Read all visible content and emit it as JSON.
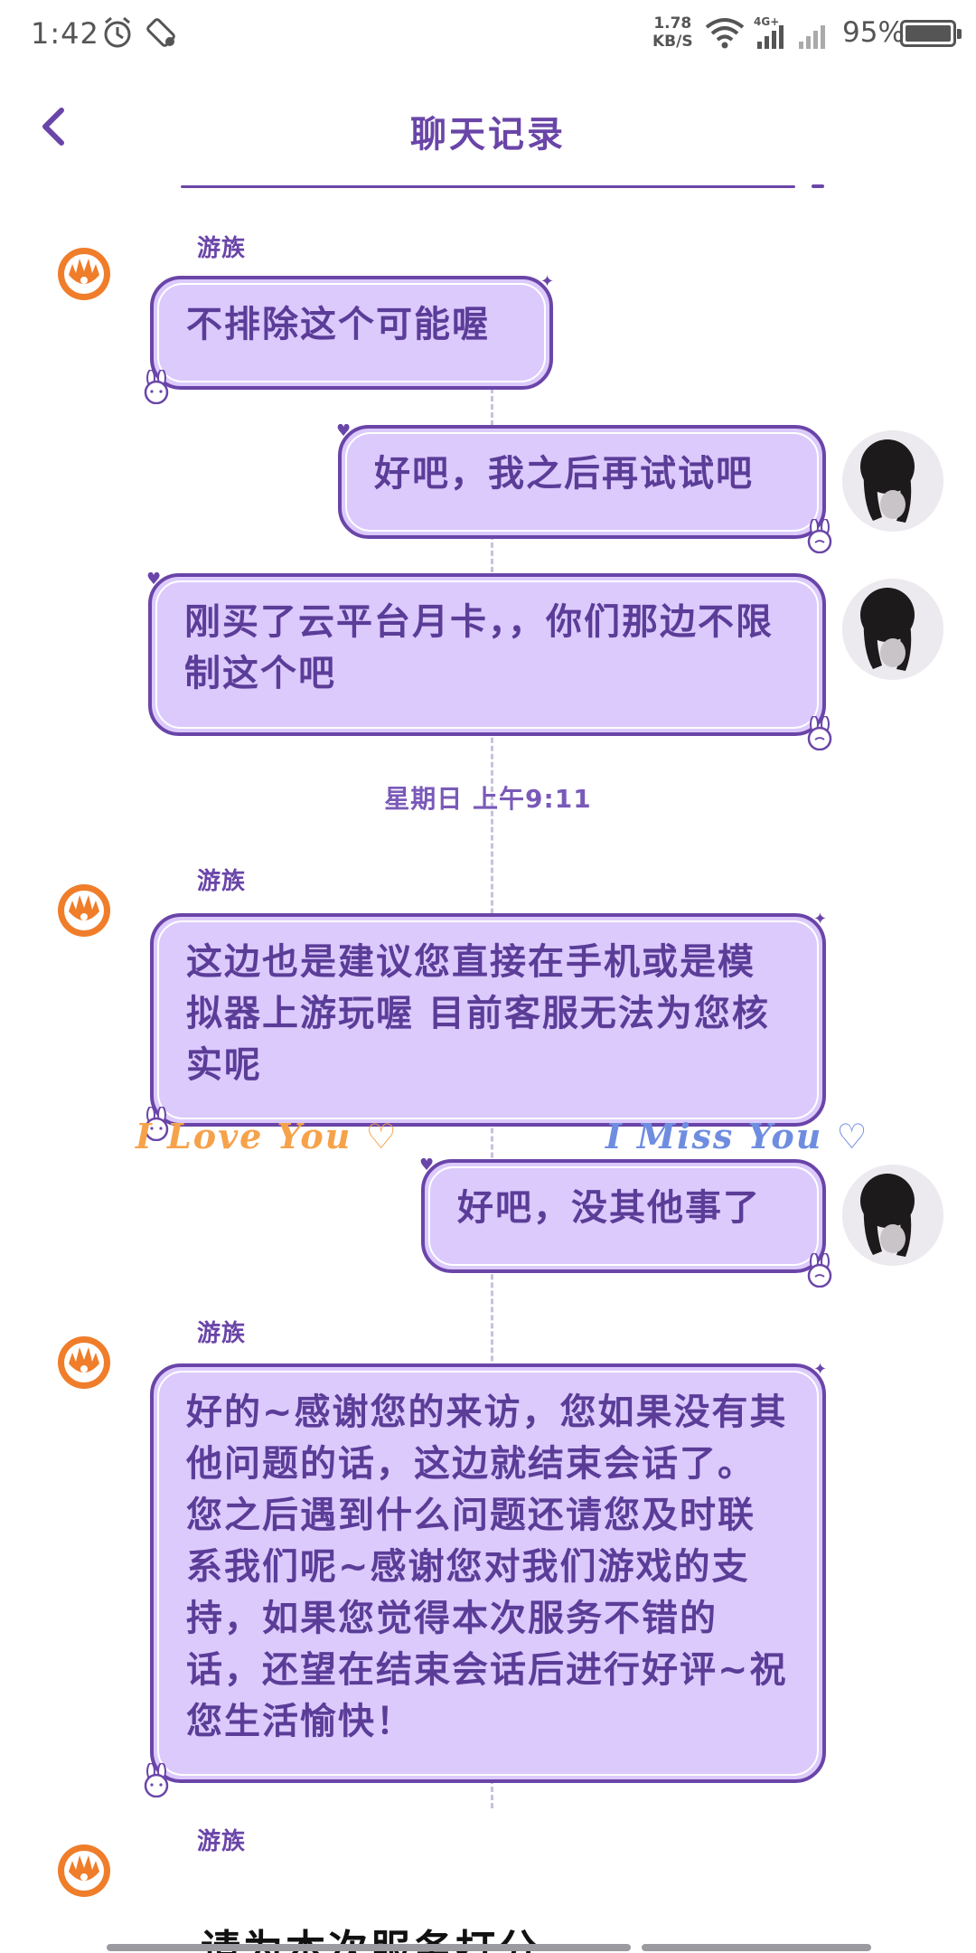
{
  "status_bar": {
    "time": "1:42",
    "net_speed_value": "1.78",
    "net_speed_unit": "KB/S",
    "network": "4G+",
    "battery": "95%"
  },
  "header": {
    "title": "聊天记录"
  },
  "agent_name": "游族",
  "messages": [
    {
      "from": "agent",
      "text": "不排除这个可能喔"
    },
    {
      "from": "user",
      "text": "好吧，我之后再试试吧"
    },
    {
      "from": "user",
      "text": "刚买了云平台月卡，，你们那边不限制这个吧"
    },
    {
      "from": "agent",
      "text": "这边也是建议您直接在手机或是模拟器上游玩喔 目前客服无法为您核实呢"
    },
    {
      "from": "user",
      "text": "好吧，没其他事了"
    },
    {
      "from": "agent",
      "text": "好的~感谢您的来访，您如果没有其他问题的话，这边就结束会话了。您之后遇到什么问题还请您及时联系我们呢~感谢您对我们游戏的支持，如果您觉得本次服务不错的话，还望在结束会话后进行好评~祝您生活愉快！"
    }
  ],
  "timestamp": "星期日 上午9:11",
  "decor": {
    "love": "I Love You ♡",
    "miss": "I Miss You ♡"
  },
  "rating_prompt": "请为本次服务打分",
  "colors": {
    "accent": "#6a45a8",
    "bubble": "#dccafd",
    "agent_icon": "#f07d2a"
  }
}
